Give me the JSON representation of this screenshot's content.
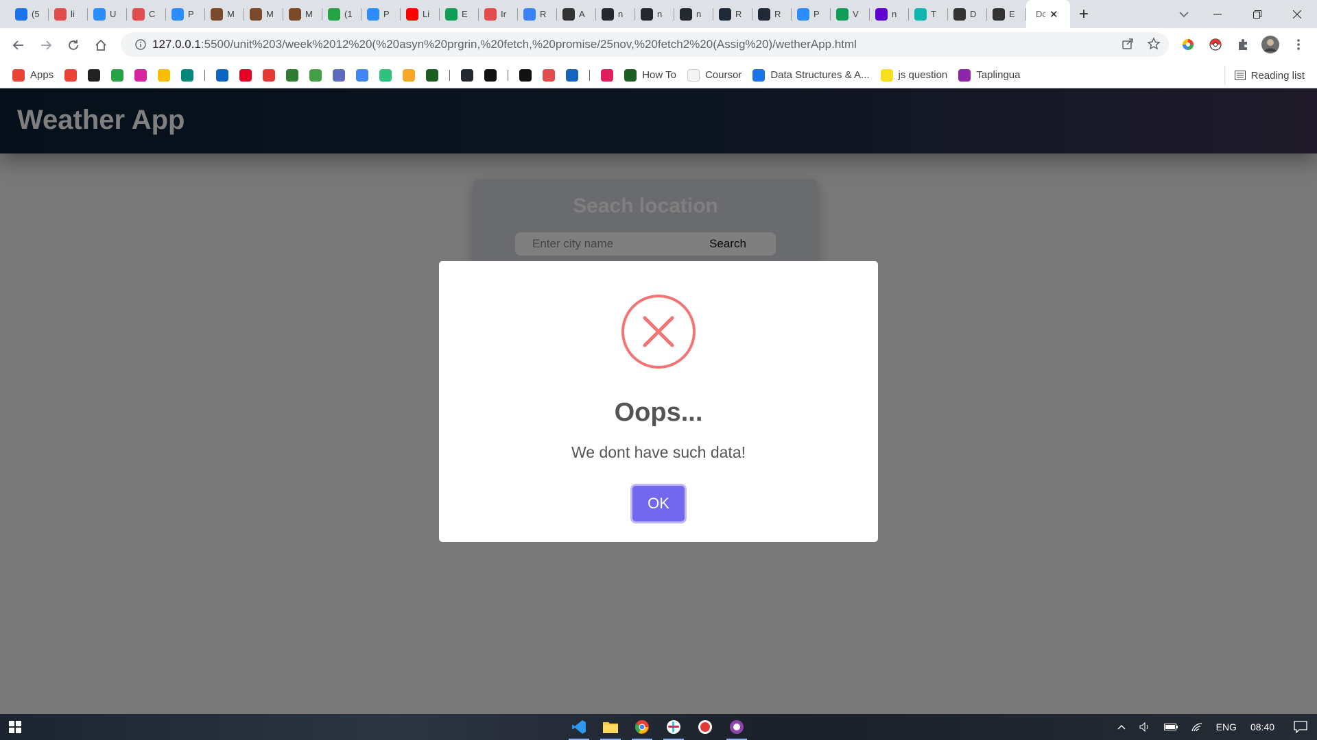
{
  "browser": {
    "tabs": [
      {
        "title": "(5",
        "color": "#1a73e8"
      },
      {
        "title": "li",
        "color": "#e24c4c"
      },
      {
        "title": "U",
        "color": "#2d8cff"
      },
      {
        "title": "C",
        "color": "#e24c4c"
      },
      {
        "title": "P",
        "color": "#2d8cff"
      },
      {
        "title": "M",
        "color": "#7b4a2a"
      },
      {
        "title": "M",
        "color": "#7b4a2a"
      },
      {
        "title": "M",
        "color": "#7b4a2a"
      },
      {
        "title": "(1",
        "color": "#25a244"
      },
      {
        "title": "P",
        "color": "#2d8cff"
      },
      {
        "title": "Li",
        "color": "#ff0000"
      },
      {
        "title": "E",
        "color": "#0f9d58"
      },
      {
        "title": "Ir",
        "color": "#e24c4c"
      },
      {
        "title": "R",
        "color": "#3b82f6"
      },
      {
        "title": "A",
        "color": "#333333"
      },
      {
        "title": "n",
        "color": "#24292f"
      },
      {
        "title": "n",
        "color": "#24292f"
      },
      {
        "title": "n",
        "color": "#24292f"
      },
      {
        "title": "R",
        "color": "#1f2937"
      },
      {
        "title": "R",
        "color": "#1f2937"
      },
      {
        "title": "P",
        "color": "#2d8cff"
      },
      {
        "title": "V",
        "color": "#0f9d58"
      },
      {
        "title": "n",
        "color": "#6001d2"
      },
      {
        "title": "T",
        "color": "#0fb5ae"
      },
      {
        "title": "D",
        "color": "#333333"
      },
      {
        "title": "E",
        "color": "#333333"
      }
    ],
    "active_tab_title": "Dc",
    "address": {
      "host": "127.0.0.1",
      "rest": ":5500/unit%203/week%2012%20(%20asyn%20prgrin,%20fetch,%20promise/25nov,%20fetch2%20(Assig%20)/wetherApp.html"
    },
    "bookmarks": [
      {
        "label": "Apps",
        "color": "#ea4335"
      },
      {
        "label": "",
        "color": "#ea4335"
      },
      {
        "label": "",
        "color": "#222222"
      },
      {
        "label": "",
        "color": "#25a244"
      },
      {
        "label": "",
        "color": "#d6249f"
      },
      {
        "label": "",
        "color": "#fbbc04"
      },
      {
        "label": "",
        "color": "#00897b"
      },
      {
        "label": "",
        "color": "#0a66c2"
      },
      {
        "label": "",
        "color": "#e60023"
      },
      {
        "label": "",
        "color": "#e53935"
      },
      {
        "label": "",
        "color": "#2e7d32"
      },
      {
        "label": "",
        "color": "#43a047"
      },
      {
        "label": "",
        "color": "#5c6bc0"
      },
      {
        "label": "",
        "color": "#4285f4"
      },
      {
        "label": "",
        "color": "#2ec27e"
      },
      {
        "label": "",
        "color": "#f9a825"
      },
      {
        "label": "",
        "color": "#1b5e20"
      },
      {
        "label": "",
        "color": "#24292f"
      },
      {
        "label": "",
        "color": "#111111"
      },
      {
        "label": "",
        "color": "#111111"
      },
      {
        "label": "",
        "color": "#e24c4c"
      },
      {
        "label": "",
        "color": "#1565c0"
      },
      {
        "label": "",
        "color": "#e01e5a"
      },
      {
        "label": "How To",
        "color": "#1b5e20"
      },
      {
        "label": "Coursor",
        "color": "#f5f5f5"
      },
      {
        "label": "Data Structures & A...",
        "color": "#1a73e8"
      },
      {
        "label": "js question",
        "color": "#f7df1e"
      },
      {
        "label": "Taplingua",
        "color": "#8e24aa"
      }
    ],
    "reading_list": "Reading list"
  },
  "app": {
    "title": "Weather App",
    "search": {
      "heading": "Seach location",
      "placeholder": "Enter city name",
      "button": "Search"
    }
  },
  "dialog": {
    "title": "Oops...",
    "message": "We dont have such data!",
    "ok": "OK",
    "icon": "error-x-icon",
    "icon_color": "#f27474",
    "button_color": "#7367f0"
  },
  "taskbar": {
    "apps": [
      "vscode-icon",
      "file-explorer-icon",
      "chrome-icon",
      "slack-icon",
      "record-icon",
      "github-desktop-icon"
    ],
    "language": "ENG",
    "time": "08:40"
  }
}
